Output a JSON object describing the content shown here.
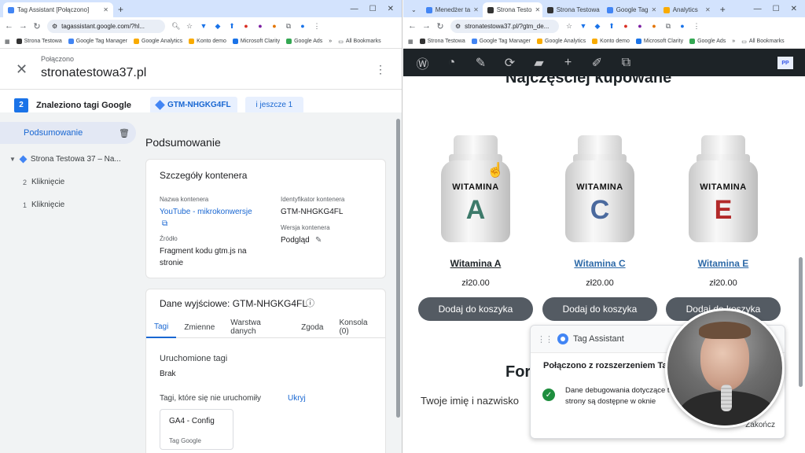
{
  "left": {
    "tabs": [
      {
        "label": "Tag Assistant [Połączono]",
        "active": true
      }
    ],
    "url": "tagassistant.google.com/?hl...",
    "bookmarks": [
      "Strona Testowa",
      "Google Tag Manager",
      "Google Analytics",
      "Konto demo",
      "Microsoft Clarity",
      "Google Ads",
      "All Bookmarks"
    ],
    "header": {
      "status": "Połączono",
      "site": "stronatestowa37.pl"
    },
    "found_count": "2",
    "found_label": "Znaleziono tagi Google",
    "gtm_chip": "GTM-NHGKG4FL",
    "more_chip": "i jeszcze 1",
    "sidebar": {
      "summary": "Podsumowanie",
      "page": "Strona Testowa 37 – Na...",
      "events": [
        {
          "num": "2",
          "label": "Kliknięcie"
        },
        {
          "num": "1",
          "label": "Kliknięcie"
        }
      ]
    },
    "main": {
      "title": "Podsumowanie",
      "container": {
        "title": "Szczegóły kontenera",
        "name_label": "Nazwa kontenera",
        "name_value": "YouTube - mikrokonwersje",
        "id_label": "Identyfikator kontenera",
        "id_value": "GTM-NHGKG4FL",
        "source_label": "Źródło",
        "source_value": "Fragment kodu gtm.js na stronie",
        "version_label": "Wersja kontenera",
        "version_value": "Podgląd"
      },
      "output": {
        "title": "Dane wyjściowe: GTM-NHGKG4FL",
        "tabs": [
          "Tagi",
          "Zmienne",
          "Warstwa danych",
          "Zgoda",
          "Konsola (0)"
        ],
        "fired_label": "Uruchomione tagi",
        "fired_value": "Brak",
        "notfired_label": "Tagi, które się nie uruchomiły",
        "hide_link": "Ukryj",
        "tag_name": "GA4 - Config",
        "tag_type": "Tag Google"
      }
    }
  },
  "right": {
    "tabs": [
      {
        "label": "Menedżer ta",
        "active": false
      },
      {
        "label": "Strona Testo",
        "active": true
      },
      {
        "label": "Strona Testowa",
        "active": false
      },
      {
        "label": "Google Tag",
        "active": false
      },
      {
        "label": "Analytics",
        "active": false
      }
    ],
    "url": "stronatestowa37.pl/?gtm_de...",
    "bookmarks": [
      "Strona Testowa",
      "Google Tag Manager",
      "Google Analytics",
      "Konto demo",
      "Microsoft Clarity",
      "Google Ads",
      "All Bookmarks"
    ],
    "wp_avatar": "PP",
    "section_title": "Najczęściej kupowane",
    "products": [
      {
        "label": "WITAMINA",
        "letter": "A",
        "letter_color": "#3d7a6a",
        "name": "Witamina A",
        "price": "zł20.00",
        "button": "Dodaj do koszyka"
      },
      {
        "label": "WITAMINA",
        "letter": "C",
        "letter_color": "#4b6a9e",
        "name": "Witamina C",
        "price": "zł20.00",
        "button": "Dodaj do koszyka"
      },
      {
        "label": "WITAMINA",
        "letter": "E",
        "letter_color": "#b22a2a",
        "name": "Witamina E",
        "price": "zł20.00",
        "button": "Dodaj do koszyka"
      }
    ],
    "form_title": "Formularz",
    "name_field_label": "Twoje imię i nazwisko"
  },
  "popup": {
    "title": "Tag Assistant",
    "connected": "Połączono z rozszerzeniem Tag Assistant",
    "message": "Dane debugowania dotyczące tej strony są dostępne w oknie rozszerzenia Tag Assistant",
    "end": "Zakończ"
  }
}
